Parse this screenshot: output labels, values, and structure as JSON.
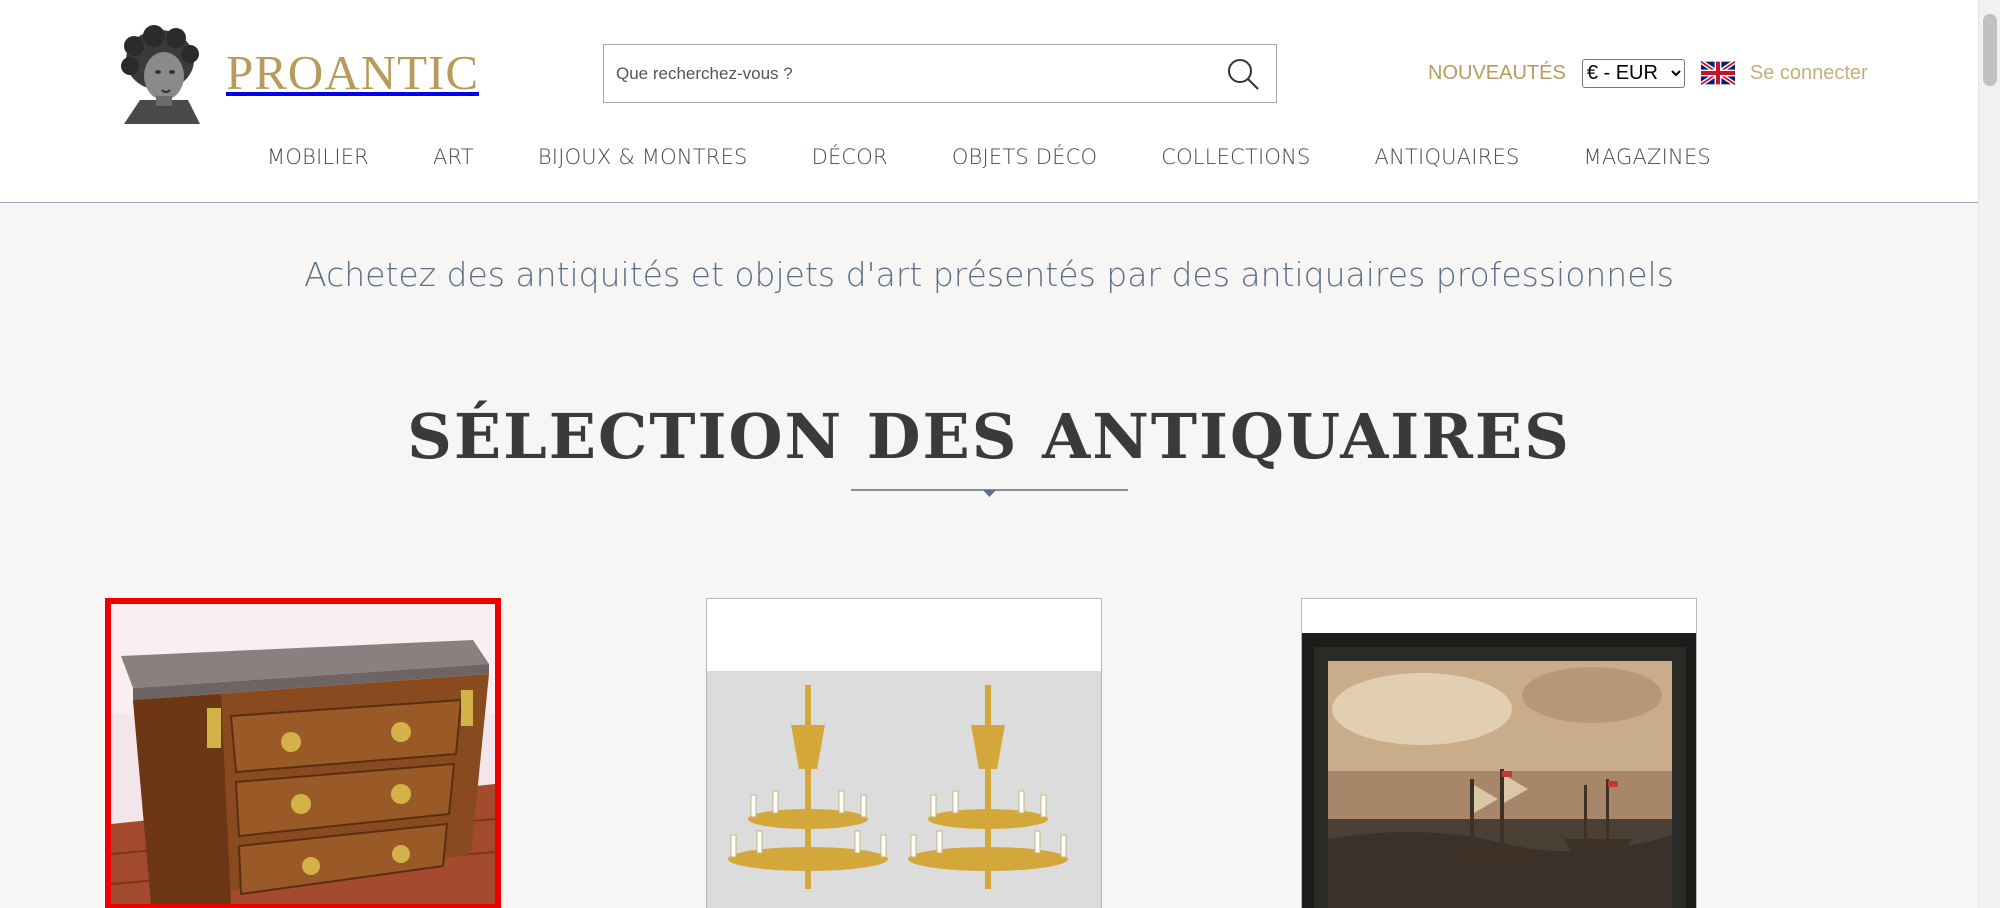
{
  "header": {
    "logo_text": "PROANTIC",
    "search": {
      "placeholder": "Que recherchez-vous ?"
    },
    "nouveautes_label": "NOUVEAUTÉS",
    "currency": {
      "selected": "€ - EUR"
    },
    "language_flag": "uk-flag-icon",
    "login_label": "Se connecter"
  },
  "nav": {
    "items": [
      {
        "label": "MOBILIER"
      },
      {
        "label": "ART"
      },
      {
        "label": "BIJOUX & MONTRES"
      },
      {
        "label": "DÉCOR"
      },
      {
        "label": "OBJETS DÉCO"
      },
      {
        "label": "COLLECTIONS"
      },
      {
        "label": "ANTIQUAIRES"
      },
      {
        "label": "MAGAZINES"
      }
    ]
  },
  "main": {
    "tagline": "Achetez des antiquités et objets d'art présentés par des antiquaires professionnels",
    "section_title": "SÉLECTION DES ANTIQUAIRES"
  },
  "colors": {
    "brand_gold": "#b89a5b",
    "nav_text": "#3f4a55",
    "tagline": "#5a6e85",
    "selection_border": "#ee0000"
  }
}
